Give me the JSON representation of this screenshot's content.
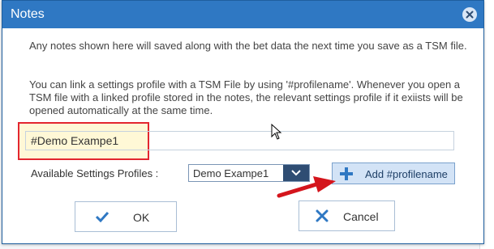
{
  "dialog": {
    "title": "Notes",
    "intro_text": "Any notes shown here will saved along with the bet data the next time you save as a TSM file.",
    "link_text": "You can link a settings profile with a TSM File by using '#profilename'. Whenever you open a TSM file with a linked profile stored in the notes, the relevant settings profile if it exiists will be opened automatically at the same time.",
    "notes_value": "#Demo Exampe1",
    "available_profiles_label": "Available Settings Profiles :",
    "selected_profile": "Demo Exampe1",
    "add_button_label": "Add #profilename",
    "ok_label": "OK",
    "cancel_label": "Cancel"
  },
  "colors": {
    "titlebar": "#2f78c3",
    "highlight_border": "#e3262f",
    "highlight_fill": "#fff8d6",
    "select_button": "#2f4d73",
    "accent_button_fill": "#d3e3f6",
    "annotation_arrow": "#d4151c"
  },
  "icons": {
    "close": "close-icon",
    "dropdown": "chevron-down-icon",
    "add": "plus-icon",
    "ok": "check-icon",
    "cancel": "x-icon"
  }
}
